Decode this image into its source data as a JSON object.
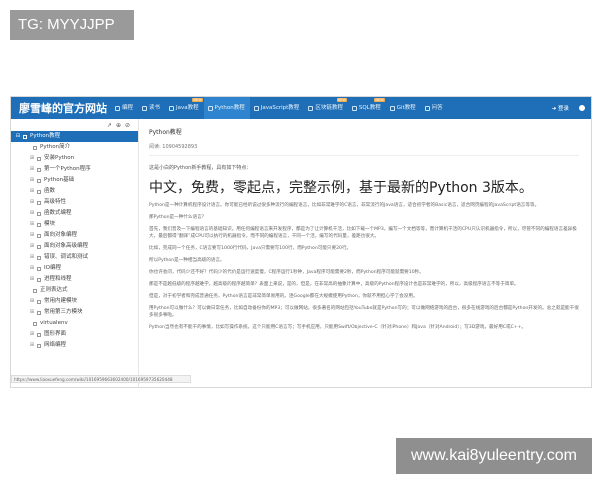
{
  "tag": "TG: MYYJJPP",
  "watermark": "www.kai8yuleentry.com",
  "nav": {
    "brand": "廖雪峰的官方网站",
    "items": [
      {
        "label": "编程",
        "hot": ""
      },
      {
        "label": "读书",
        "hot": ""
      },
      {
        "label": "Java教程",
        "hot": "NEW"
      },
      {
        "label": "Python教程",
        "hot": ""
      },
      {
        "label": "JavaScript教程",
        "hot": ""
      },
      {
        "label": "区块链教程",
        "hot": "NEW"
      },
      {
        "label": "SQL教程",
        "hot": "NEW"
      },
      {
        "label": "Git教程",
        "hot": ""
      },
      {
        "label": "问答",
        "hot": ""
      }
    ],
    "login": "登录"
  },
  "sidebar": {
    "tools": [
      "↗",
      "⊕",
      "⊘"
    ],
    "items": [
      {
        "label": "Python教程",
        "level": 0,
        "toggle": "⊟",
        "selected": true
      },
      {
        "label": "Python简介",
        "level": 2,
        "toggle": "",
        "selected": false
      },
      {
        "label": "安装Python",
        "level": 1,
        "toggle": "⊞",
        "selected": false
      },
      {
        "label": "第一个Python程序",
        "level": 1,
        "toggle": "⊞",
        "selected": false
      },
      {
        "label": "Python基础",
        "level": 1,
        "toggle": "⊞",
        "selected": false
      },
      {
        "label": "函数",
        "level": 1,
        "toggle": "⊞",
        "selected": false
      },
      {
        "label": "高级特性",
        "level": 1,
        "toggle": "⊞",
        "selected": false
      },
      {
        "label": "函数式编程",
        "level": 1,
        "toggle": "⊞",
        "selected": false
      },
      {
        "label": "模块",
        "level": 1,
        "toggle": "⊞",
        "selected": false
      },
      {
        "label": "面向对象编程",
        "level": 1,
        "toggle": "⊞",
        "selected": false
      },
      {
        "label": "面向对象高级编程",
        "level": 1,
        "toggle": "⊞",
        "selected": false
      },
      {
        "label": "错误、调试和测试",
        "level": 1,
        "toggle": "⊞",
        "selected": false
      },
      {
        "label": "IO编程",
        "level": 1,
        "toggle": "⊞",
        "selected": false
      },
      {
        "label": "进程和线程",
        "level": 1,
        "toggle": "⊞",
        "selected": false
      },
      {
        "label": "正则表达式",
        "level": 2,
        "toggle": "",
        "selected": false
      },
      {
        "label": "常用内建模块",
        "level": 1,
        "toggle": "⊞",
        "selected": false
      },
      {
        "label": "常用第三方模块",
        "level": 1,
        "toggle": "⊞",
        "selected": false
      },
      {
        "label": "virtualenv",
        "level": 2,
        "toggle": "",
        "selected": false
      },
      {
        "label": "图形界面",
        "level": 1,
        "toggle": "⊞",
        "selected": false
      },
      {
        "label": "网络编程",
        "level": 1,
        "toggle": "⊞",
        "selected": false
      }
    ]
  },
  "main": {
    "crumb": "Python教程",
    "views": "阅读: 10904592893",
    "intro": "这是小白的Python新手教程，具有如下特点：",
    "headline": "中文，免费，零起点，完整示例，基于最新的Python 3版本。",
    "paragraphs": [
      "Python是一种计算机程序设计语言。你可能已经听说过很多种流行的编程语言，比如非常难学的C语言，非常流行的Java语言，适合初学者的Basic语言，适合网页编程的JavaScript语言等等。",
      "那Python是一种什么语言？",
      "首先，我们普及一下编程语言的基础知识。用任何编程语言来开发程序，都是为了让计算机干活，比如下载一个MP3，编写一个文档等等，而计算机干活的CPU只认识机器指令，所以，尽管不同的编程语言差异极大，最后都得“翻译”成CPU可以执行的机器指令。而不同的编程语言，干同一个活，编写的代码量，差距也很大。",
      "比如，完成同一个任务，C语言要写1000行代码，Java只需要写100行，而Python可能只要20行。",
      "所以Python是一种相当高级的语言。",
      "你也许会问，代码少还不好？代码少的代价是运行速度慢，C程序运行1秒钟，Java程序可能需要2秒，而Python程序可能就需要10秒。",
      "那是不是越低级的程序越难学，越高级的程序越简单？表面上来说，是的，但是，在非常高的抽象计算中，高级的Python程序设计也是非常难学的，所以，高级程序语言不等于简单。",
      "但是，对于初学者和完成普通任务，Python语言是非常简单易用的。连Google都在大规模使用Python，你就不用担心学了会没用。",
      "用Python可以做什么？可以做日常任务，比如自动备份你的MP3；可以做网站，很多著名的网站包括YouTube就是Python写的；可以做网络游戏的后台，很多在线游戏的后台都是Python开发的。总之就是能干很多很多事啦。",
      "Python当然也有不能干的事情，比如写操作系统，这个只能用C语言写；写手机应用，只能用Swift/Objective-C（针对iPhone）和Java（针对Android）；写3D游戏，最好用C或C++。"
    ],
    "status_url": "https://www.liaoxuefeng.com/wiki/1016959663602400/1016959735620448"
  }
}
